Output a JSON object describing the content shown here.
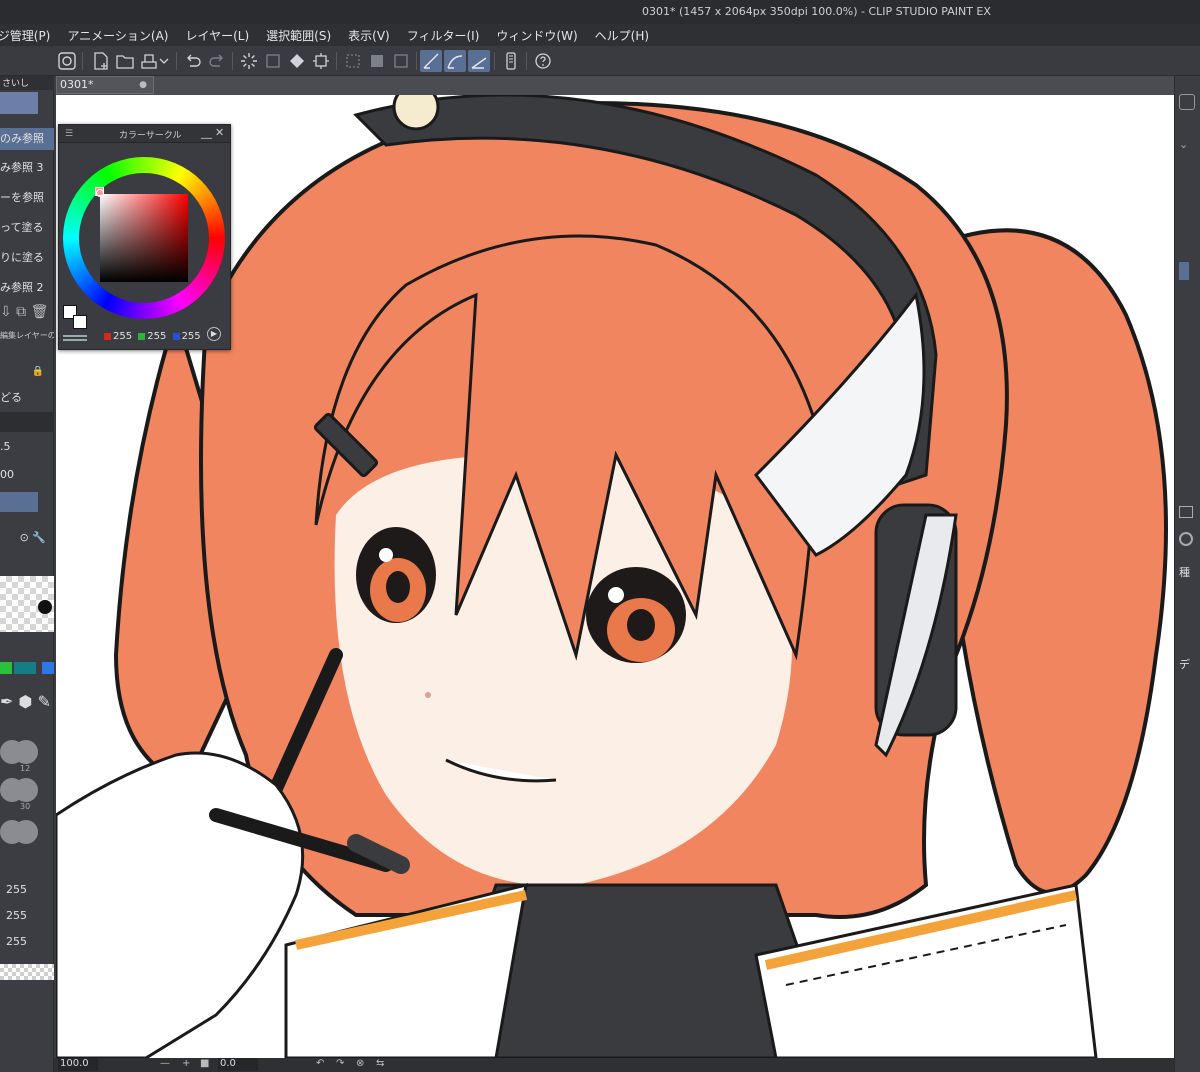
{
  "window": {
    "title": "0301* (1457 x 2064px 350dpi 100.0%) - CLIP STUDIO PAINT EX"
  },
  "menu": [
    "ージ管理(P)",
    "アニメーション(A)",
    "レイヤー(L)",
    "選択範囲(S)",
    "表示(V)",
    "フィルター(I)",
    "ウィンドウ(W)",
    "ヘルプ(H)"
  ],
  "document_tab": {
    "label": "0301*",
    "close": "●"
  },
  "color_circle": {
    "title": "カラーサークル",
    "minimize": "__",
    "close": "✕",
    "r_value": "255",
    "g_value": "255",
    "b_value": "255"
  },
  "left_panel": {
    "tab_label": "さいし",
    "rows": [
      "のみ参照",
      "み参照 3",
      "ーを参照",
      "って塗る",
      "りに塗る",
      "み参照 2"
    ],
    "layer_text": "編集レイヤーの",
    "back_text": "どる",
    "num1": ".5",
    "num2": "00",
    "brush_size_12": "12",
    "brush_size_30": "30",
    "r_value": "255",
    "g_value": "255",
    "b_value": "255"
  },
  "right_panel": {
    "text1": "種",
    "text2": "デ"
  },
  "status": {
    "zoom": "100.0",
    "rotation": "0.0"
  },
  "colors": {
    "hair": "#f0855f",
    "hair_dark": "#d9603d",
    "skin": "#fcefe6",
    "outline": "#1a1a1a",
    "accent_orange": "#f3a33a",
    "dark_suit": "#3a3b3f",
    "selection_blue": "#5a6f94"
  }
}
